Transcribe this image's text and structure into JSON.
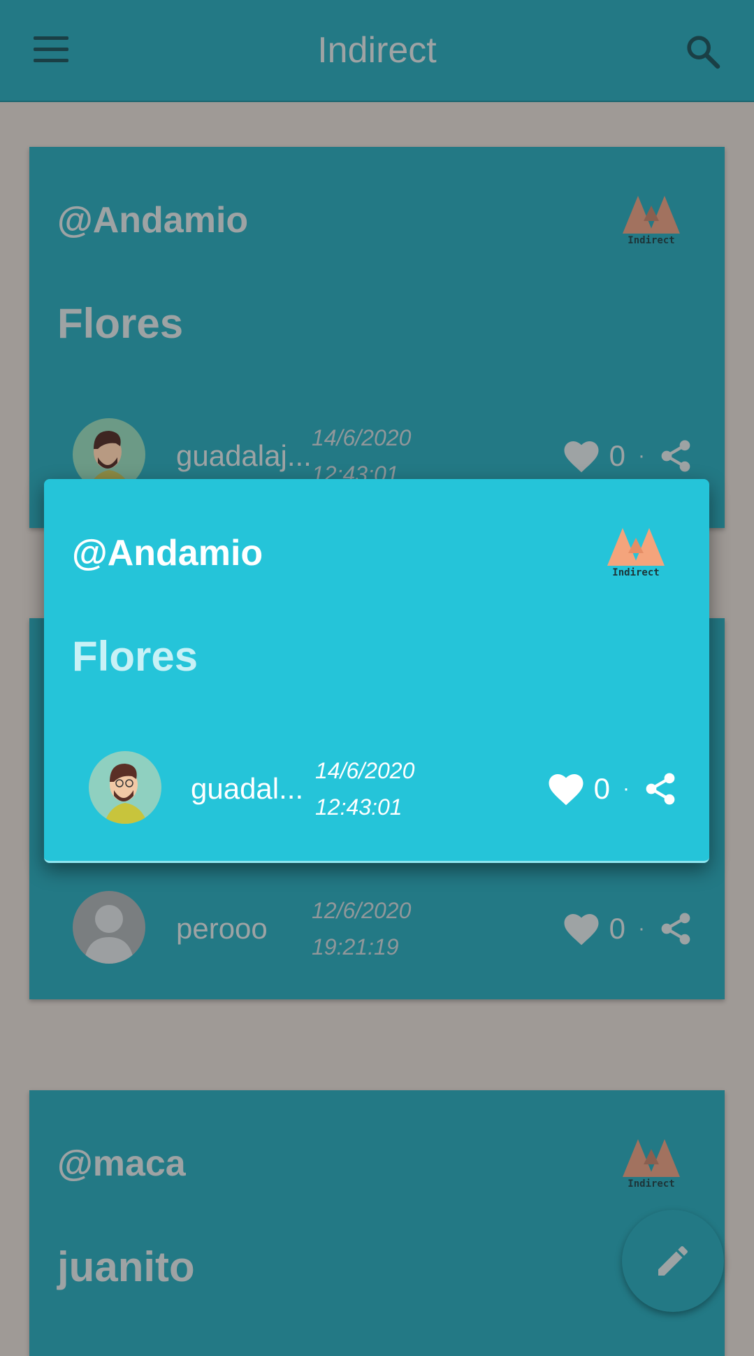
{
  "app": {
    "title": "Indirect"
  },
  "colors": {
    "appbar": "#237985",
    "background": "#9f9a96",
    "popup": "#25c4d9",
    "logo_accent": "#f4a47c"
  },
  "feed": [
    {
      "handle": "@Andamio",
      "subject": "Flores",
      "logo_text": "Indirect",
      "user": "guadalaj...",
      "date": "14/6/2020",
      "time": "12:43:01",
      "likes": "0",
      "separator": "·"
    },
    {
      "handle": "",
      "subject": "",
      "logo_text": "",
      "user": "perooo",
      "date": "12/6/2020",
      "time": "19:21:19",
      "likes": "0",
      "separator": "·"
    },
    {
      "handle": "@maca",
      "subject": "juanito",
      "logo_text": "Indirect"
    }
  ],
  "popup": {
    "handle": "@Andamio",
    "subject": "Flores",
    "logo_text": "Indirect",
    "user": "guadal...",
    "date": "14/6/2020",
    "time": "12:43:01",
    "likes": "0",
    "separator": "·"
  },
  "icons": {
    "menu": "menu-icon",
    "search": "search-icon",
    "like": "heart-icon",
    "share": "share-icon",
    "compose": "pencil-icon"
  }
}
